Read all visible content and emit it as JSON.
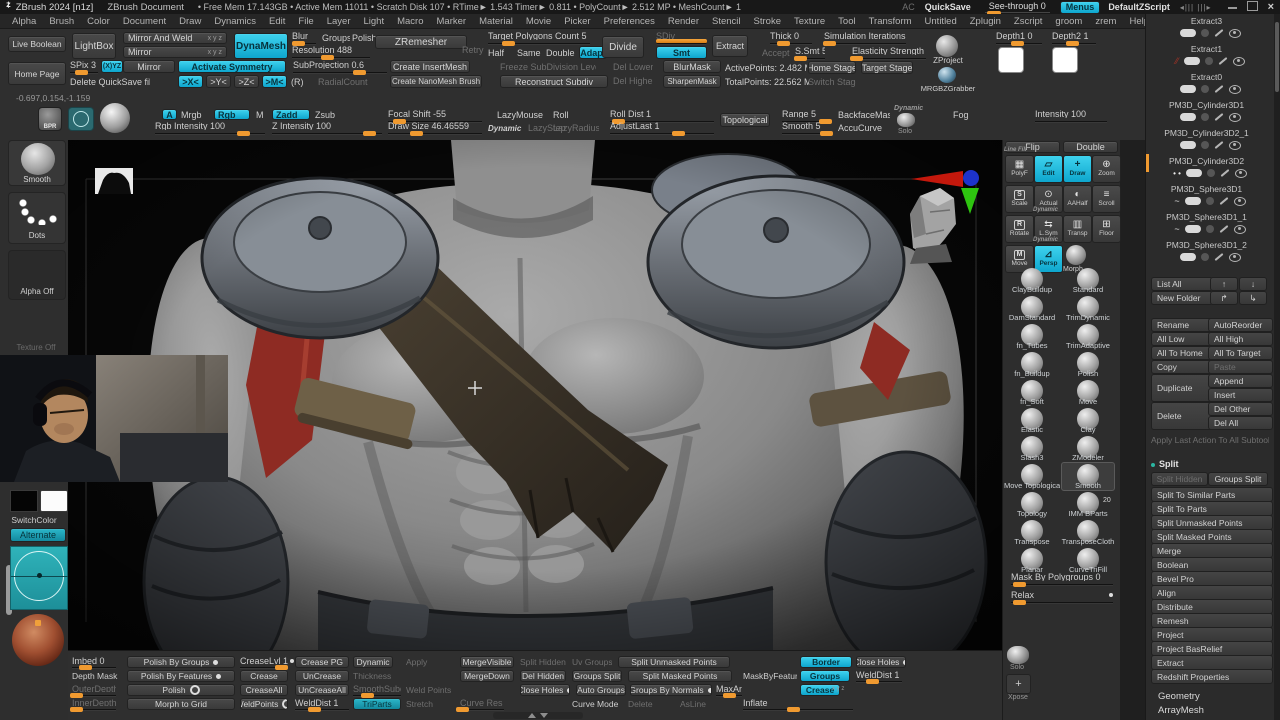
{
  "titlebar": {
    "app": "ZBrush 2024 [n1z]",
    "doc": "ZBrush Document",
    "stats": "• Free Mem 17.143GB • Active Mem 11011 • Scratch Disk 107 • RTime► 1.543 Timer► 0.811 • PolyCount► 2.512 MP • MeshCount► 1",
    "ac": "AC",
    "quicksave": "QuickSave",
    "seethrough": "See-through 0",
    "menus": "Menus",
    "zscript": "DefaultZScript",
    "brush_steppers": "◂||| |||▸",
    "close": "×"
  },
  "menubar": {
    "items": [
      "Alpha",
      "Brush",
      "Color",
      "Document",
      "Draw",
      "Dynamics",
      "Edit",
      "File",
      "Layer",
      "Light",
      "Macro",
      "Marker",
      "Material",
      "Movie",
      "Picker",
      "Preferences",
      "Render",
      "Stencil",
      "Stroke",
      "Texture",
      "Tool",
      "Transform",
      "Untitled",
      "Zplugin",
      "Zscript",
      "groom",
      "zrem",
      "Help"
    ]
  },
  "shelf": {
    "live_boolean": "Live Boolean",
    "home_page": "Home Page",
    "lightbox": "LightBox",
    "spix": "SPix 3",
    "xyz": "(X)YZ",
    "delete_quicksave": "Delete QuickSave files",
    "mirror_and_weld": "Mirror And Weld",
    "mirror2": "Mirror",
    "mirror3": "Mirror",
    "axis_hint": "x y z",
    "activate_symmetry": "Activate Symmetry",
    "x": ">X<",
    "y": ">Y<",
    "z": ">Z<",
    "m": ">M<",
    "r": "(R)",
    "radial_count": "RadialCount",
    "dynamesh": "DynaMesh",
    "blur": "Blur",
    "groups": "Groups",
    "polish": "Polish",
    "resolution": "Resolution 488",
    "subprojection": "SubProjection 0.6",
    "zremesher": "ZRemesher",
    "retry": "Retry",
    "create_insertmesh": "Create InsertMesh",
    "create_nanomesh": "Create NanoMesh Brush",
    "target_polygons": "Target Polygons Count 5",
    "half": "Half",
    "same": "Same",
    "double": "Double",
    "adapt": "Adapt",
    "freeze_subdiv": "Freeze SubDivision Levels",
    "reconstruct": "Reconstruct Subdiv",
    "divide": "Divide",
    "sdiv": "SDiv",
    "smt": "Smt",
    "del_lower": "Del Lower",
    "del_higher": "Del Higher",
    "extract": "Extract",
    "blurmask": "BlurMask",
    "sharpenmask": "SharpenMask",
    "thick": "Thick 0",
    "accept": "Accept",
    "ssmt": "S.Smt 5",
    "sim_iter": "Simulation Iterations 0",
    "elasticity": "Elasticity Strength 0",
    "active_points": "ActivePoints: 2.482 Mil",
    "total_points": "TotalPoints: 22.562 Mil",
    "home_stage": "Home Stage",
    "target_stage": "Target Stage",
    "switch_stage": "Switch Stage",
    "zproject": "ZProject",
    "mrgbzgrabber": "MRGBZGrabber",
    "depth1": "Depth1 0",
    "depth2": "Depth2 1",
    "coords": "-0.697,0.154,-1.159"
  },
  "brushrow": {
    "bpr": "BPR",
    "a": "A",
    "mrgb": "Mrgb",
    "rgb": "Rgb",
    "m": "M",
    "rgb_intensity": "Rgb Intensity 100",
    "zadd": "Zadd",
    "zsub": "Zsub",
    "z_intensity": "Z Intensity 100",
    "focal_shift": "Focal Shift -55",
    "draw_size": "Draw Size 46.46559",
    "dynamic": "Dynamic",
    "lazymouse": "LazyMouse",
    "lazystep": "LazyStep",
    "roll": "Roll",
    "lazyradius": "LazyRadius",
    "roll_dist": "Roll Dist 1",
    "adjustlast": "AdjustLast 1",
    "topological": "Topological",
    "range": "Range 5",
    "smooth": "Smooth 5",
    "backfacemask": "BackfaceMask",
    "accucurve": "AccuCurve",
    "dynamic2": "Dynamic",
    "solo": "Solo",
    "fog": "Fog",
    "intensity": "Intensity 100"
  },
  "leftbar": {
    "smooth": "Smooth",
    "dots": "Dots",
    "alpha_off": "Alpha Off",
    "texture_off": "Texture Off",
    "switchcolor": "SwitchColor",
    "alternate": "Alternate"
  },
  "nav": {
    "flip": "Flip",
    "double": "Double",
    "grid": [
      {
        "label": "PolyF",
        "glyph": "▦",
        "sub": "Line Fill"
      },
      {
        "label": "Edit",
        "glyph": "▱",
        "active": true
      },
      {
        "label": "Draw",
        "glyph": "+",
        "active": true
      },
      {
        "label": "Zoom",
        "glyph": "⊕"
      },
      {
        "label": "Scale",
        "glyph": "S",
        "letter": true
      },
      {
        "label": "Actual",
        "glyph": "⊙"
      },
      {
        "label": "AAHalf",
        "glyph": "◐"
      },
      {
        "label": "Scroll",
        "glyph": "≡"
      },
      {
        "label": "Rotate",
        "glyph": "R",
        "letter": true
      },
      {
        "label": "L.Sym",
        "glyph": "⇆",
        "sub": "Dynamic"
      },
      {
        "label": "Transp",
        "glyph": "▥"
      },
      {
        "label": "Floor",
        "glyph": "⊞"
      },
      {
        "label": "Move",
        "glyph": "M",
        "letter": true
      },
      {
        "label": "Persp",
        "glyph": "⊿",
        "active": true,
        "sub": "Dynamic"
      },
      {
        "label": "Morph",
        "glyph": "",
        "sphere": true
      }
    ]
  },
  "brushes": {
    "rows": [
      [
        "ClayBuildup",
        "Standard"
      ],
      [
        "DamStandard",
        "TrimDynamic"
      ],
      [
        "fn_Tubes",
        "TrimAdaptive"
      ],
      [
        "fn_Buildup",
        "Polish"
      ],
      [
        "fn_Soft",
        "Move"
      ],
      [
        "Elastic",
        "Clay"
      ],
      [
        "Slash3",
        "ZModeler"
      ],
      [
        "Move Topological",
        "Smooth"
      ],
      [
        "Topology",
        "IMM BParts"
      ],
      [
        "Transpose",
        "TransposeCloth"
      ],
      [
        "Planar",
        "CurveTriFill"
      ]
    ],
    "selected": "Smooth",
    "badge": "20",
    "mask_slider": "Mask By Polygroups 0",
    "relax": "Relax",
    "solo": "Solo",
    "xpose": "Xpose"
  },
  "subtools": {
    "items": [
      "Extract3",
      "Extract1",
      "Extract0",
      "PM3D_Cylinder3D1",
      "PM3D_Cylinder3D2_1",
      "PM3D_Cylinder3D2",
      "PM3D_Sphere3D1",
      "PM3D_Sphere3D1_1",
      "PM3D_Sphere3D1_2"
    ],
    "selected_index": 5
  },
  "subtool_ops": {
    "list_all": "List All",
    "up": "↑",
    "down": "↓",
    "new_folder": "New Folder",
    "redo": "↱",
    "indent": "↳",
    "rename": "Rename",
    "autoreorder": "AutoReorder",
    "all_low": "All Low",
    "all_high": "All High",
    "all_to_home": "All To Home",
    "all_to_target": "All To Target",
    "copy": "Copy",
    "paste": "Paste",
    "duplicate": "Duplicate",
    "append": "Append",
    "insert": "Insert",
    "delete": "Delete",
    "del_other": "Del Other",
    "del_all": "Del All",
    "apply_last": "Apply Last Action To All Subtools"
  },
  "split": {
    "header": "Split",
    "split_hidden": "Split Hidden",
    "groups_split": "Groups Split",
    "rows": [
      "Split To Similar Parts",
      "Split To Parts",
      "Split Unmasked Points",
      "Split Masked Points",
      "Merge",
      "Boolean",
      "Bevel Pro",
      "Align",
      "Distribute",
      "Remesh",
      "Project",
      "Project BasRelief",
      "Extract",
      "Redshift Properties"
    ]
  },
  "sections": {
    "geometry": "Geometry",
    "arraymesh": "ArrayMesh"
  },
  "bottom": {
    "imbed": "Imbed 0",
    "polish_by_groups": "Polish By Groups",
    "creaselvl": "CreaseLvl 15",
    "crease_pg": "Crease PG",
    "dynamic": "Dynamic",
    "apply": "Apply",
    "depth_mask": "Depth Mask",
    "polish_by_features": "Polish By Features",
    "crease": "Crease",
    "uncrease": "UnCrease",
    "thickness": "Thickness",
    "outerdepth": "OuterDepth",
    "polish": "Polish",
    "creaseall": "CreaseAll",
    "uncreaseall": "UnCreaseAll",
    "smoothsubdiv": "SmoothSubdiv",
    "weld_points": "Weld Points",
    "innerdepth": "InnerDepth",
    "morph_to_grid": "Morph to Grid",
    "weldpoints": "WeldPoints",
    "welddist": "WeldDist 1",
    "triparts": "TriParts",
    "stretch": "Stretch",
    "mergevisible": "MergeVisible",
    "split_hidden": "Split Hidden",
    "uv_groups": "Uv Groups",
    "split_unmasked": "Split Unmasked Points",
    "mergedown": "MergeDown",
    "del_hidden": "Del Hidden",
    "groups_split": "Groups Split",
    "split_masked": "Split Masked Points",
    "close_holes": "Close Holes",
    "auto_groups": "Auto Groups",
    "groups_by_normals": "Groups By Normals",
    "maxan": "MaxAn",
    "curve_res": "Curve Res",
    "curve_mode": "Curve Mode",
    "delete": "Delete",
    "asline": "AsLine",
    "maskbyfeature": "MaskByFeature",
    "border": "Border",
    "groups": "Groups",
    "crease2": "Crease",
    "close_holes2": "Close Holes",
    "welddist2": "WeldDist 1",
    "inflate": "Inflate",
    "xyz": "x y z"
  }
}
